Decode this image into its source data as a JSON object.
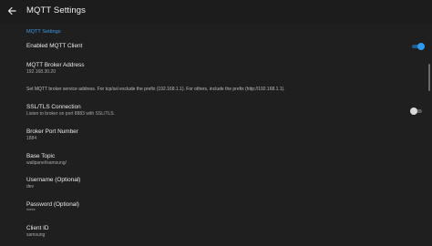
{
  "appbar": {
    "title": "MQTT Settings",
    "back_icon": "arrow-back-icon"
  },
  "section": {
    "header": "MQTT Settings"
  },
  "prefs": {
    "enable_mqtt": {
      "title": "Enabled MQTT Client",
      "checked": true
    },
    "broker_address": {
      "title": "MQTT Broker Address",
      "value": "192.168.30.20"
    },
    "broker_note": "Set MQTT broker service address. For tcp/ssl exclude the prefix (192.168.1.1). For others, include the prefix (http://192.168.1.1).",
    "ssl_tls": {
      "title": "SSL/TLS Connection",
      "summary": "Listen to broker on port 8883 with SSL/TLS.",
      "checked": false
    },
    "broker_port": {
      "title": "Broker Port Number",
      "value": "1884"
    },
    "base_topic": {
      "title": "Base Topic",
      "value": "wallpanel/samsung/"
    },
    "username": {
      "title": "Username (Optional)",
      "value": "dev"
    },
    "password": {
      "title": "Password (Optional)",
      "value": "*****"
    },
    "client_id": {
      "title": "Client ID",
      "value": "samsung"
    }
  },
  "colors": {
    "accent": "#2f9bf0",
    "background": "#1f1f1f",
    "appbar": "#1c1c1c"
  }
}
